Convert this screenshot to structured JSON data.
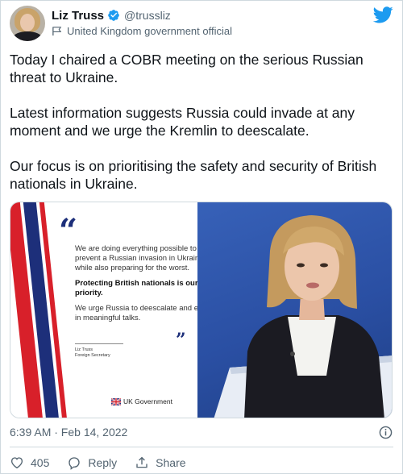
{
  "author": {
    "display_name": "Liz Truss",
    "handle": "@trussliz",
    "label": "United Kingdom government official",
    "avatar_icon": "profile-photo",
    "verified_icon": "verified-badge-icon",
    "label_icon": "government-flag-icon"
  },
  "brand": {
    "logo_icon": "twitter-bird-icon",
    "color": "#1d9bf0"
  },
  "tweet": {
    "paragraphs": [
      "Today I chaired a COBR meeting on the serious Russian threat to Ukraine.",
      "Latest information suggests Russia could invade at any moment and we urge the Kremlin to deescalate.",
      "Our focus is on prioritising the safety and security of British nationals in Ukraine."
    ]
  },
  "media": {
    "quote_open": "“",
    "quote_close": "”",
    "quote_paragraphs": [
      "We are doing everything possible to prevent a Russian invasion in Ukraine, while also preparing for the worst.",
      "Protecting British nationals is our top priority.",
      "We urge Russia to deescalate and engage in meaningful talks."
    ],
    "signature_name": "Liz Truss",
    "signature_title": "Foreign Secretary",
    "footer_brand": "UK Government",
    "colors": {
      "red": "#d8202a",
      "navy": "#1d2f7a",
      "photo_bg": "#2a4fa3"
    }
  },
  "meta": {
    "timestamp": "6:39 AM · Feb 14, 2022",
    "info_icon": "info-icon"
  },
  "actions": {
    "like_count": "405",
    "reply_label": "Reply",
    "share_label": "Share",
    "like_icon": "heart-icon",
    "reply_icon": "reply-bubble-icon",
    "share_icon": "share-upload-icon"
  }
}
